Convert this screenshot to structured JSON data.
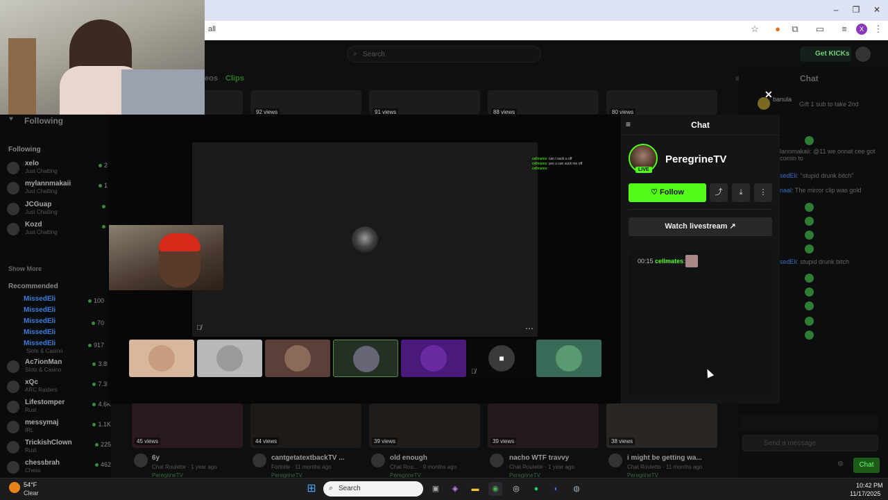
{
  "browser": {
    "url_fragment": "all",
    "profile_initial": "X"
  },
  "site": {
    "search_placeholder": "Search",
    "get_kicks": "Get KICKs",
    "tabs": [
      "eos",
      "Clips"
    ],
    "chat_title": "Chat",
    "chat_placeholder": "Send a message",
    "chat_button": "Chat",
    "gift_text": "Gift 1 sub to take 2nd",
    "gift_user": "banula",
    "bg_chat_lines": [
      {
        "user": "",
        "text": ""
      },
      {
        "user": "",
        "text": "lannmakaii: @11 we onnat cee got comin to"
      },
      {
        "user": "sedEli",
        "text": ": \"stupid drunk bitch\""
      },
      {
        "user": "naal",
        "text": ": The mirror clip was gold"
      },
      {
        "user": "sedEli",
        "text": ": stupid drunk bitch"
      }
    ]
  },
  "sidebar": {
    "following_title": "Following",
    "following_label": "Following",
    "show_more": "Show More",
    "recommended_label": "Recommended",
    "following": [
      {
        "name": "xelo",
        "sub": "Just Chatting",
        "count": "26"
      },
      {
        "name": "mylannmakaii",
        "sub": "Just Chatting",
        "count": "13"
      },
      {
        "name": "JCGuap",
        "sub": "Just Chatting",
        "count": "5"
      },
      {
        "name": "Kozd",
        "sub": "Just Chatting",
        "count": "1"
      }
    ],
    "recommended": [
      {
        "name": "MissedEli",
        "sub": "",
        "count": "100"
      },
      {
        "name": "MissedEli",
        "sub": "",
        "count": ""
      },
      {
        "name": "MissedEli",
        "sub": "",
        "count": "70"
      },
      {
        "name": "MissedEli",
        "sub": "",
        "count": ""
      },
      {
        "name": "MissedEli",
        "sub": "Slots & Casino",
        "count": "917"
      },
      {
        "name": "Ac7ionMan",
        "sub": "Slots & Casino",
        "count": "3.8K"
      },
      {
        "name": "xQc",
        "sub": "ARC Raiders",
        "count": "7.3K"
      },
      {
        "name": "Lifestomper",
        "sub": "Rust",
        "count": "4.6K"
      },
      {
        "name": "messymaj",
        "sub": "IRL",
        "count": "1.1K"
      },
      {
        "name": "TrickishClown",
        "sub": "Rust",
        "count": "225"
      },
      {
        "name": "chessbrah",
        "sub": "Chess",
        "count": "462"
      }
    ]
  },
  "videos_top": [
    {
      "views": "92 views"
    },
    {
      "views": "91 views"
    },
    {
      "views": "88 views"
    },
    {
      "views": "80 views"
    }
  ],
  "videos": [
    {
      "views": "45 views",
      "title": "6y",
      "meta": "Chat Roulette · 1 year ago",
      "channel": "PeregrineTV"
    },
    {
      "views": "44 views",
      "title": "cantgetatextbackTV ...",
      "meta": "Fortnite · 11 months ago",
      "channel": "PeregrineTV"
    },
    {
      "views": "39 views",
      "title": "old enough",
      "meta": "Chat Rou... · 9 months ago",
      "channel": "PeregrineTV"
    },
    {
      "views": "39 views",
      "title": "nacho WTF travvy",
      "meta": "Chat Roulette · 1 year ago",
      "channel": "PeregrineTV"
    },
    {
      "views": "38 views",
      "title": "i might be getting wa...",
      "meta": "Chat Roulette · 11 months ago",
      "channel": "PeregrineTV"
    }
  ],
  "modal": {
    "chat_title": "Chat",
    "streamer": "PeregrineTV",
    "live": "LIVE",
    "follow": "Follow",
    "watch": "Watch livestream",
    "chat_msg": {
      "time": "00:15",
      "user": "cellmates",
      "sep": ":"
    },
    "mini_chat": [
      {
        "user": "cellmates",
        "text": ": can I suck u off"
      },
      {
        "user": "cellmates",
        "text": ": yes u can suck me off"
      },
      {
        "user": "cellmates",
        "text": ":"
      }
    ]
  },
  "taskbar": {
    "temp": "54°F",
    "weather": "Clear",
    "search": "Search",
    "time": "10:42 PM",
    "date": "11/17/2025"
  },
  "colors": {
    "accent": "#53fc18",
    "bg": "#0b0c0d",
    "panel": "#141516"
  }
}
